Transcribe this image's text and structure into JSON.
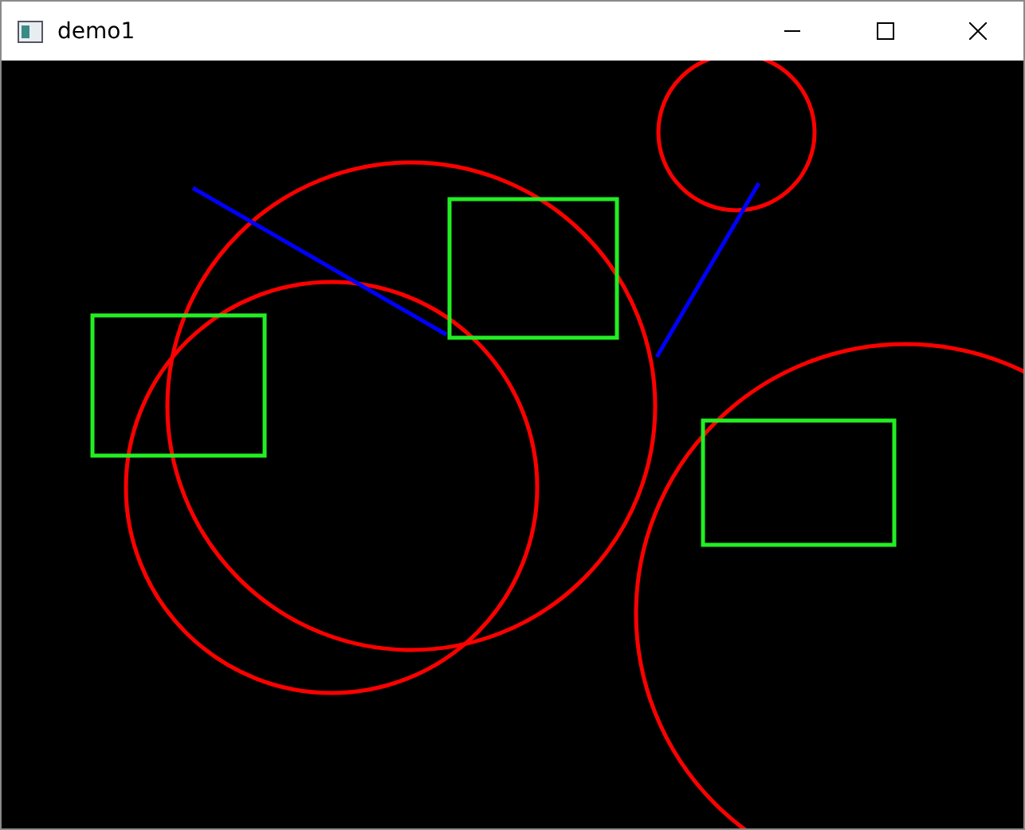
{
  "window": {
    "title": "demo1",
    "buttons": [
      {
        "kind": "minimize"
      },
      {
        "kind": "maximize"
      },
      {
        "kind": "close"
      }
    ]
  },
  "canvas": {
    "shapes": [
      {
        "kind": "circle"
      },
      {
        "kind": "circle"
      },
      {
        "kind": "circle"
      },
      {
        "kind": "circle"
      },
      {
        "kind": "rectangle"
      },
      {
        "kind": "rectangle"
      },
      {
        "kind": "rectangle"
      },
      {
        "kind": "line"
      },
      {
        "kind": "line"
      }
    ]
  }
}
